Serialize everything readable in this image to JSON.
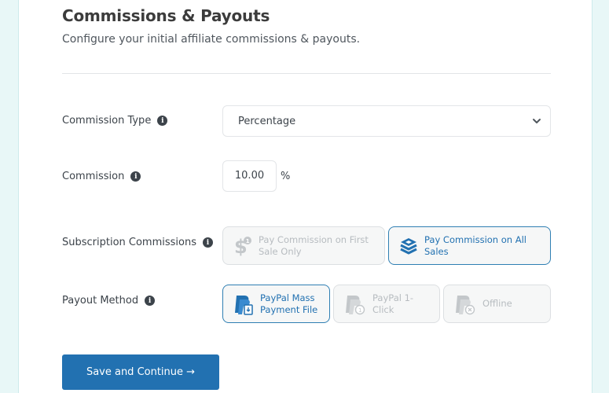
{
  "header": {
    "title": "Commissions & Payouts",
    "subtitle": "Configure your initial affiliate commissions & payouts."
  },
  "form": {
    "commission_type": {
      "label": "Commission Type",
      "info_icon": "info-icon",
      "selected": "Percentage"
    },
    "commission": {
      "label": "Commission",
      "info_icon": "info-icon",
      "value": "10.00",
      "unit": "%"
    },
    "subscription_commissions": {
      "label": "Subscription Commissions",
      "info_icon": "info-icon",
      "options": [
        {
          "label": "Pay Commission on First Sale Only",
          "icon": "dollar-one-icon",
          "selected": false
        },
        {
          "label": "Pay Commission on All Sales",
          "icon": "layers-stack-icon",
          "selected": true
        }
      ]
    },
    "payout_method": {
      "label": "Payout Method",
      "info_icon": "info-icon",
      "options": [
        {
          "label": "PayPal Mass Payment File",
          "icon": "paypal-file-icon",
          "selected": true
        },
        {
          "label": "PayPal 1-Click",
          "icon": "paypal-one-click-icon",
          "selected": false
        },
        {
          "label": "Offline",
          "icon": "paypal-offline-icon",
          "selected": false
        }
      ]
    }
  },
  "actions": {
    "save_label": "Save and Continue →"
  },
  "colors": {
    "accent": "#2271b1",
    "background": "#e8f7f7",
    "disabled_text": "#b7bcc0"
  }
}
